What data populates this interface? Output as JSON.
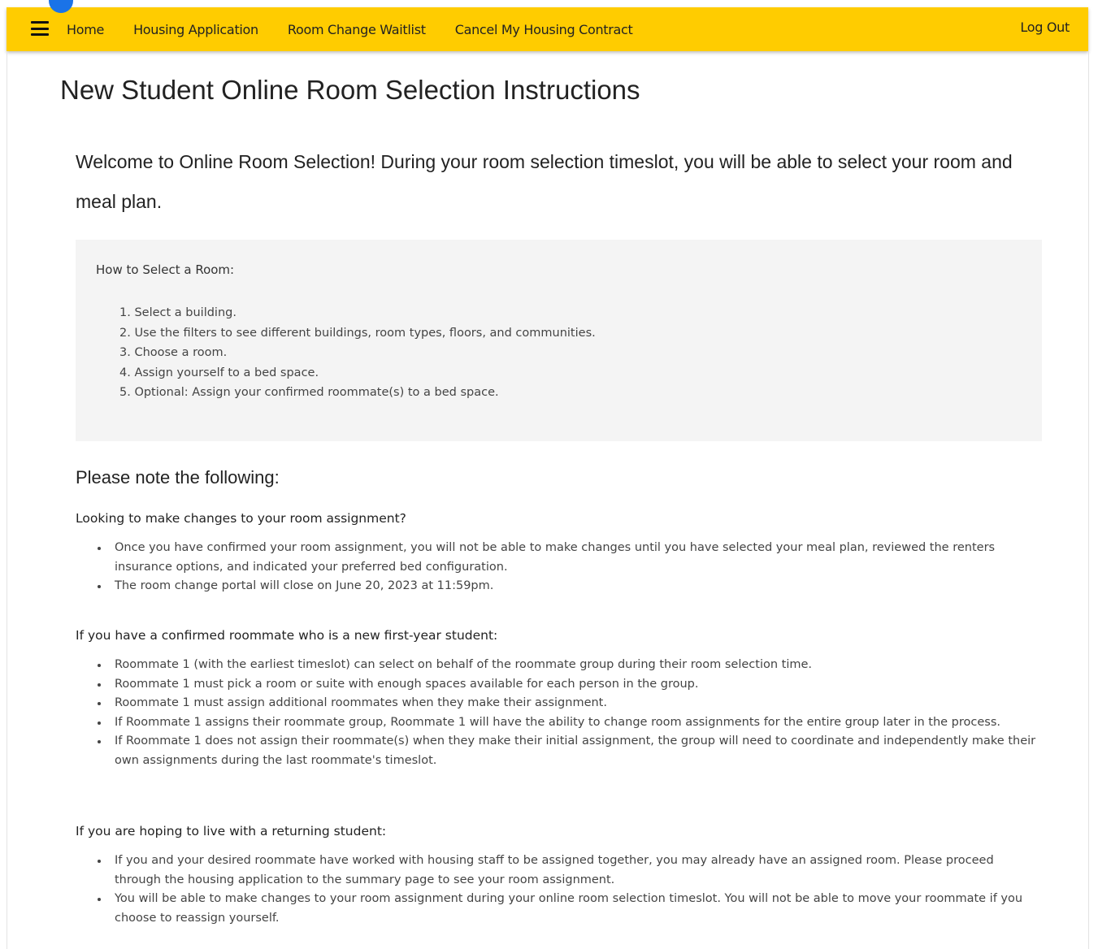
{
  "nav": {
    "items": [
      "Home",
      "Housing Application",
      "Room Change Waitlist",
      "Cancel My Housing Contract"
    ],
    "logout": "Log Out"
  },
  "page_title": "New Student Online Room Selection Instructions",
  "welcome": "Welcome to Online Room Selection! During your room selection timeslot, you will be able to select your room and meal plan.",
  "how_to": {
    "title": "How to Select a Room:",
    "steps": [
      "1. Select a building.",
      "2. Use the filters to see different buildings, room types, floors, and communities.",
      "3. Choose a room.",
      "4. Assign yourself to a bed space.",
      "5. Optional: Assign your confirmed roommate(s) to a bed space."
    ]
  },
  "notes": {
    "heading": "Please note the following:",
    "sections": [
      {
        "heading": "Looking to make changes to your room assignment?",
        "items": [
          "Once you have confirmed your room assignment, you will not be able to make changes until you have selected your meal plan, reviewed the renters insurance options, and indicated your preferred bed configuration.",
          "The room change portal will close on June 20, 2023 at 11:59pm."
        ]
      },
      {
        "heading": "If you have a confirmed roommate who is a new first-year student:",
        "items": [
          "Roommate 1 (with the earliest timeslot) can select on behalf of the roommate group during their room selection time.",
          "Roommate 1 must pick a room or suite with enough spaces available for each person in the group.",
          "Roommate 1 must assign additional roommates when they make their assignment.",
          "If Roommate 1 assigns their roommate group, Roommate 1 will have the ability to change room assignments for the entire group later in the process.",
          "If Roommate 1 does not assign their roommate(s) when they make their initial assignment, the group will need to coordinate and independently make their own assignments during the last roommate's timeslot."
        ]
      },
      {
        "heading": "If you are hoping to live with a returning student:",
        "items": [
          "If you and your desired roommate have worked with housing staff to be assigned together, you may already have an assigned room. Please proceed through the housing application to the summary page to see your room assignment.",
          "You will be able to make changes to your room assignment during your online room selection timeslot. You will not be able to move your roommate if you choose to reassign yourself."
        ]
      }
    ]
  },
  "colors": {
    "nav_bar": "#ffcc00",
    "badge": "#1a73e8",
    "info_box": "#f4f4f4"
  },
  "icons": {
    "menu": "hamburger-menu-icon"
  }
}
